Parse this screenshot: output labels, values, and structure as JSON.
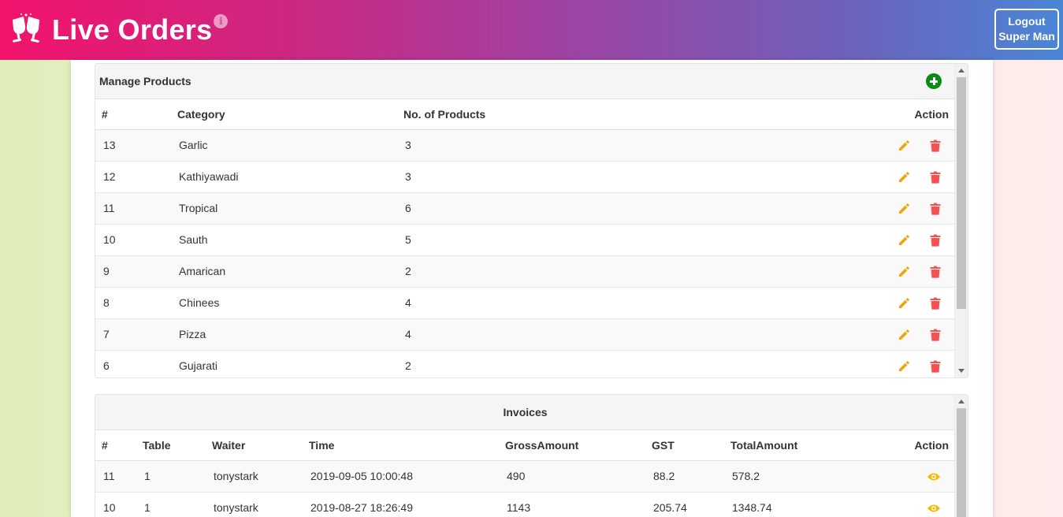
{
  "header": {
    "title": "Live Orders",
    "info_glyph": "i",
    "logout_line1": "Logout",
    "logout_line2": "Super Man",
    "logo_icon": "toast-glasses-icon"
  },
  "manage_products": {
    "title": "Manage Products",
    "columns": {
      "id": "#",
      "category": "Category",
      "count": "No. of Products",
      "action": "Action"
    },
    "rows": [
      {
        "id": "13",
        "category": "Garlic",
        "count": "3"
      },
      {
        "id": "12",
        "category": "Kathiyawadi",
        "count": "3"
      },
      {
        "id": "11",
        "category": "Tropical",
        "count": "6"
      },
      {
        "id": "10",
        "category": "Sauth",
        "count": "5"
      },
      {
        "id": "9",
        "category": "Amarican",
        "count": "2"
      },
      {
        "id": "8",
        "category": "Chinees",
        "count": "4"
      },
      {
        "id": "7",
        "category": "Pizza",
        "count": "4"
      },
      {
        "id": "6",
        "category": "Gujarati",
        "count": "2"
      }
    ]
  },
  "invoices": {
    "title": "Invoices",
    "columns": {
      "id": "#",
      "table": "Table",
      "waiter": "Waiter",
      "time": "Time",
      "gross": "GrossAmount",
      "gst": "GST",
      "total": "TotalAmount",
      "action": "Action"
    },
    "rows": [
      {
        "id": "11",
        "table": "1",
        "waiter": "tonystark",
        "time": "2019-09-05 10:00:48",
        "gross": "490",
        "gst": "88.2",
        "total": "578.2"
      },
      {
        "id": "10",
        "table": "1",
        "waiter": "tonystark",
        "time": "2019-08-27 18:26:49",
        "gross": "1143",
        "gst": "205.74",
        "total": "1348.74"
      }
    ]
  },
  "colors": {
    "edit": "#f5a300",
    "delete": "#f05454",
    "add": "#0b8a16",
    "view": "#f5b800"
  }
}
